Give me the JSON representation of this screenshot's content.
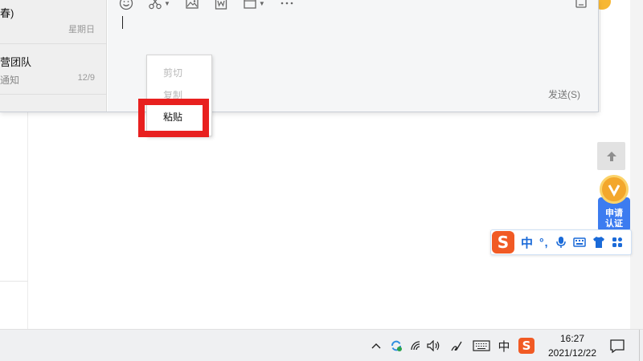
{
  "conversations": [
    {
      "name": "春)",
      "preview": "",
      "time": "星期日"
    },
    {
      "name": "营团队",
      "preview": "通知",
      "time": "12/9"
    }
  ],
  "editor": {
    "send_label": "发送(S)"
  },
  "toolbar_icons": [
    "emoji-icon",
    "scissors-icon",
    "image-icon",
    "word-doc-icon",
    "screenshot-icon",
    "more-icon",
    "history-icon"
  ],
  "context_menu": {
    "items": [
      {
        "label": "剪切",
        "enabled": false
      },
      {
        "label": "复制",
        "enabled": false
      },
      {
        "label": "粘贴",
        "enabled": true
      }
    ]
  },
  "apply_badge": {
    "label": "申请认证"
  },
  "ime": {
    "mode": "中",
    "punct": "°,"
  },
  "taskbar": {
    "ime_indicator": "中",
    "time": "16:27",
    "date": "2021/12/22"
  },
  "colors": {
    "highlight": "#e8201f",
    "sogou": "#f15a24",
    "ime_blue": "#1a6ad8",
    "badge_blue": "#3c7cf0",
    "badge_gold": "#f3a72c"
  }
}
